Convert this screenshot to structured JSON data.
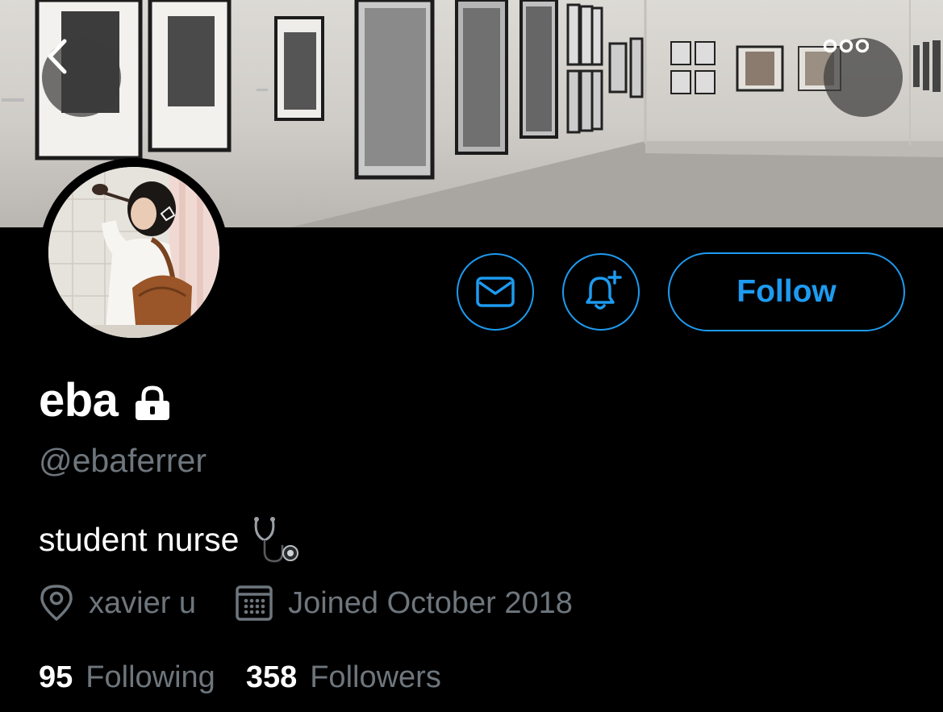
{
  "header": {
    "back_icon": "chevron-left-icon",
    "more_icon": "more-horizontal-icon"
  },
  "profile": {
    "display_name": "eba",
    "protected_icon": "lock-icon",
    "handle": "@ebaferrer",
    "bio": "student nurse",
    "bio_emoji": "stethoscope-icon",
    "location": "xavier u",
    "location_icon": "location-pin-icon",
    "joined": "Joined October 2018",
    "joined_icon": "calendar-icon"
  },
  "actions": {
    "message_icon": "envelope-icon",
    "notify_icon": "bell-plus-icon",
    "follow_label": "Follow"
  },
  "stats": {
    "following_count": "95",
    "following_label": "Following",
    "followers_count": "358",
    "followers_label": "Followers"
  },
  "colors": {
    "accent": "#1d9bf0",
    "secondary_text": "#6e767d",
    "background": "#000000"
  }
}
